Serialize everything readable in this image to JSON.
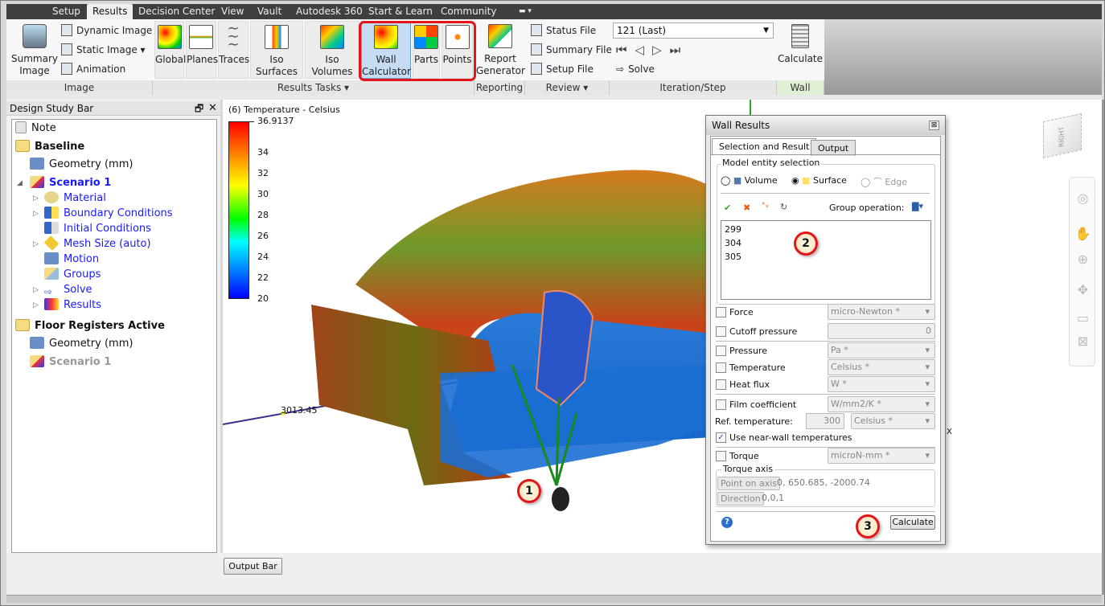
{
  "menu_tabs": [
    {
      "label": "Setup"
    },
    {
      "label": "Results",
      "active": true
    },
    {
      "label": "Decision Center"
    },
    {
      "label": "View"
    },
    {
      "label": "Vault"
    },
    {
      "label": "Autodesk 360"
    },
    {
      "label": "Start & Learn"
    },
    {
      "label": "Community"
    }
  ],
  "ribbon": {
    "image": {
      "label": "Image",
      "summary": "Summary Image",
      "dynamic": "Dynamic Image",
      "static": "Static Image",
      "animation": "Animation"
    },
    "results_tasks": {
      "label": "Results Tasks",
      "items": [
        "Global",
        "Planes",
        "Traces",
        "Iso Surfaces",
        "Iso Volumes",
        "Wall Calculator",
        "Parts",
        "Points"
      ],
      "selected": "Wall Calculator"
    },
    "reporting": {
      "label": "Reporting",
      "report": "Report Generator"
    },
    "review": {
      "label": "Review",
      "status": "Status File",
      "summary": "Summary File",
      "setup": "Setup File"
    },
    "iteration": {
      "label": "Iteration/Step",
      "value": "121 (Last)",
      "solve": "Solve"
    },
    "wall": {
      "label": "Wall",
      "calculate": "Calculate"
    }
  },
  "design_study_bar": {
    "title": "Design Study Bar",
    "items": [
      {
        "label": "Note",
        "icon": "note-icon"
      },
      {
        "label": "Baseline",
        "icon": "design-folder-icon"
      },
      {
        "label": "Geometry (mm)",
        "icon": "geometry-icon"
      },
      {
        "label": "Scenario 1",
        "icon": "scenario-icon"
      },
      {
        "label": "Material",
        "icon": "material-icon"
      },
      {
        "label": "Boundary Conditions",
        "icon": "boundary-conditions-icon"
      },
      {
        "label": "Initial Conditions",
        "icon": "initial-conditions-icon"
      },
      {
        "label": "Mesh Size (auto)",
        "icon": "mesh-icon"
      },
      {
        "label": "Motion",
        "icon": "motion-icon"
      },
      {
        "label": "Groups",
        "icon": "groups-icon"
      },
      {
        "label": "Solve",
        "icon": "solve-icon"
      },
      {
        "label": "Results",
        "icon": "results-icon"
      },
      {
        "label": "Floor Registers Active",
        "icon": "design-folder-icon"
      },
      {
        "label": "Geometry (mm)",
        "icon": "geometry-icon"
      },
      {
        "label": "Scenario 1",
        "icon": "scenario-icon"
      }
    ]
  },
  "legend": {
    "title": "(6) Temperature - Celsius",
    "max": "36.9137",
    "ticks": [
      "34",
      "32",
      "30",
      "28",
      "26",
      "24",
      "22",
      "20"
    ],
    "colors": [
      "#ff0000",
      "#ffff00",
      "#00ff00",
      "#00ffff",
      "#0000ff"
    ]
  },
  "viewport": {
    "axis_label": "3013.45",
    "axis_x": "X",
    "viewcube_face": "RIGHT"
  },
  "callouts": [
    "1",
    "2",
    "3"
  ],
  "dialog": {
    "title": "Wall Results",
    "tabs": [
      "Selection and Result",
      "Output"
    ],
    "entity_group": "Model entity selection",
    "radios": [
      {
        "label": "Volume",
        "checked": false
      },
      {
        "label": "Surface",
        "checked": true
      },
      {
        "label": "Edge",
        "checked": false,
        "disabled": true
      }
    ],
    "group_operation": "Group operation:",
    "selected_ids": [
      "299",
      "304",
      "305"
    ],
    "rows": {
      "force": {
        "label": "Force",
        "unit": "micro-Newton *",
        "checked": false
      },
      "cutoff": {
        "label": "Cutoff pressure",
        "value": "0",
        "checked": false
      },
      "pressure": {
        "label": "Pressure",
        "unit": "Pa *",
        "checked": false
      },
      "temperature": {
        "label": "Temperature",
        "unit": "Celsius *",
        "checked": false
      },
      "heatflux": {
        "label": "Heat flux",
        "unit": "W *",
        "checked": false
      },
      "film": {
        "label": "Film coefficient",
        "unit": "W/mm2/K *",
        "checked": false
      },
      "reftemp": {
        "label": "Ref. temperature:",
        "value": "300",
        "unit": "Celsius *"
      },
      "nearwall": {
        "label": "Use near-wall temperatures",
        "checked": true
      },
      "torque": {
        "label": "Torque",
        "unit": "microN-mm *",
        "checked": false
      }
    },
    "torque_axis": {
      "label": "Torque axis",
      "point_btn": "Point on axis",
      "point": "0, 650.685, -2000.74",
      "dir_btn": "Direction",
      "dir": "0,0,1"
    },
    "calculate": "Calculate"
  },
  "output_bar": "Output Bar"
}
